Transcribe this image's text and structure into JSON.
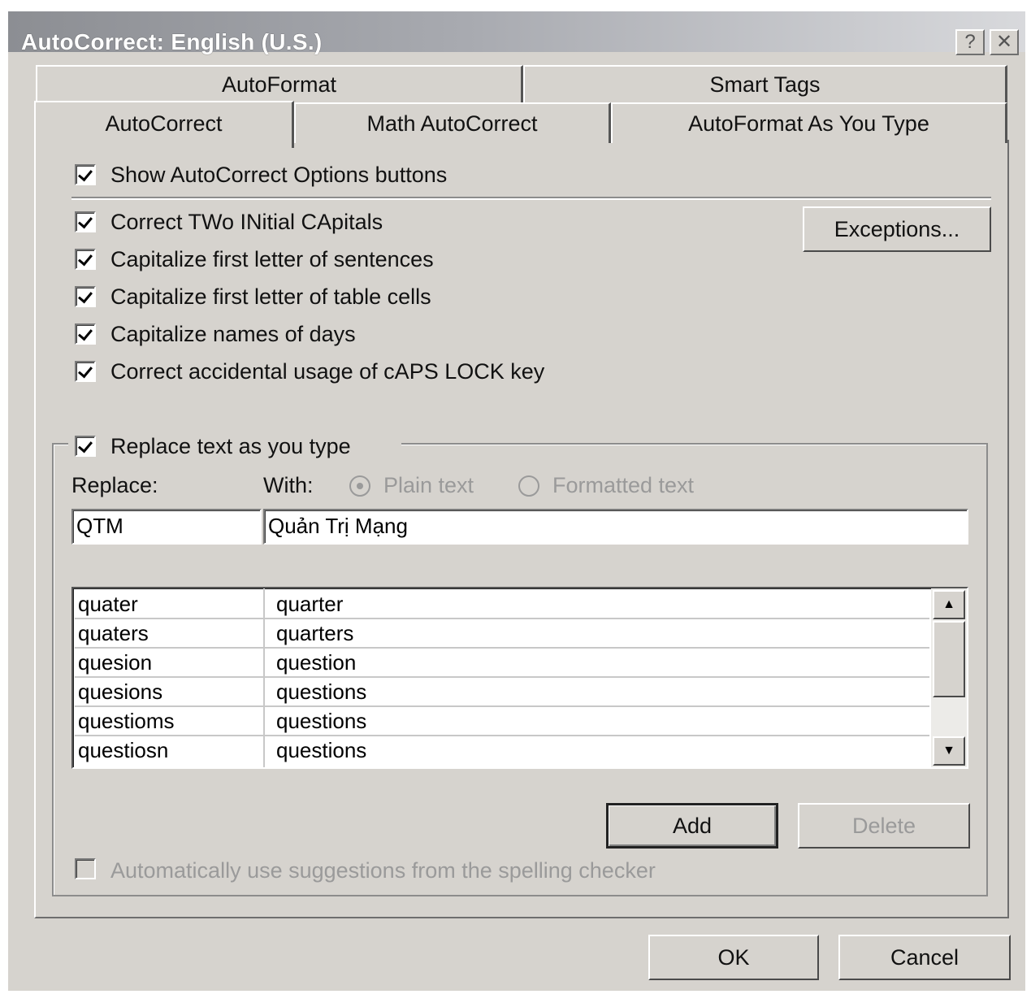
{
  "window": {
    "title": "AutoCorrect: English (U.S.)",
    "help_glyph": "?",
    "close_glyph": "✕"
  },
  "tabs": {
    "back_row": [
      {
        "label": "AutoFormat"
      },
      {
        "label": "Smart Tags"
      }
    ],
    "front_row": [
      {
        "label": "AutoCorrect",
        "active": true
      },
      {
        "label": "Math AutoCorrect"
      },
      {
        "label": "AutoFormat As You Type"
      }
    ]
  },
  "options": {
    "show_buttons": {
      "label": "Show AutoCorrect Options buttons",
      "checked": true
    },
    "exceptions_button": "Exceptions...",
    "items": [
      {
        "label": "Correct TWo INitial CApitals",
        "checked": true
      },
      {
        "label": "Capitalize first letter of sentences",
        "checked": true
      },
      {
        "label": "Capitalize first letter of table cells",
        "checked": true
      },
      {
        "label": "Capitalize names of days",
        "checked": true
      },
      {
        "label": "Correct accidental usage of cAPS LOCK key",
        "checked": true
      }
    ]
  },
  "replace_group": {
    "toggle_label": "Replace text as you type",
    "checked": true,
    "replace_label": "Replace:",
    "with_label": "With:",
    "plain_text_label": "Plain text",
    "formatted_text_label": "Formatted text",
    "selected_format": "plain",
    "replace_value": "QTM",
    "with_value": "Quản Trị Mạng",
    "entries": [
      {
        "replace": "quater",
        "with": "quarter"
      },
      {
        "replace": "quaters",
        "with": "quarters"
      },
      {
        "replace": "quesion",
        "with": "question"
      },
      {
        "replace": "quesions",
        "with": "questions"
      },
      {
        "replace": "questioms",
        "with": "questions"
      },
      {
        "replace": "questiosn",
        "with": "questions"
      }
    ],
    "add_button": "Add",
    "delete_button": "Delete",
    "spelling_label": "Automatically use suggestions from the spelling checker",
    "spelling_checked": false
  },
  "footer": {
    "ok_button": "OK",
    "cancel_button": "Cancel"
  }
}
